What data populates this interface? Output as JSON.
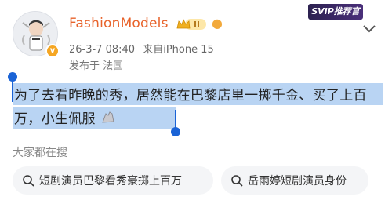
{
  "header": {
    "username": "FashionModels",
    "svip_banner": "SVIP推荐官",
    "timestamp": "26-3-7 08:40",
    "source": "来自iPhone 15",
    "location": "发布于 法国"
  },
  "post": {
    "text": "为了去看昨晚的秀，居然能在巴黎店里一掷千金、买了上百万，小生佩服"
  },
  "search": {
    "section_title": "大家都在搜",
    "chips": [
      {
        "label": "短剧演员巴黎看秀豪掷上百万"
      },
      {
        "label": "岳雨婷短剧演员身份"
      }
    ]
  },
  "colors": {
    "username": "#e8632b",
    "selection": "#b9d4f3",
    "handle": "#1a63d6"
  },
  "icons": [
    "avatar",
    "verified-badge-icon",
    "level-crown-icon",
    "fish-emoji-icon",
    "chevron-down-icon",
    "search-icon",
    "clap-emoji-icon"
  ]
}
